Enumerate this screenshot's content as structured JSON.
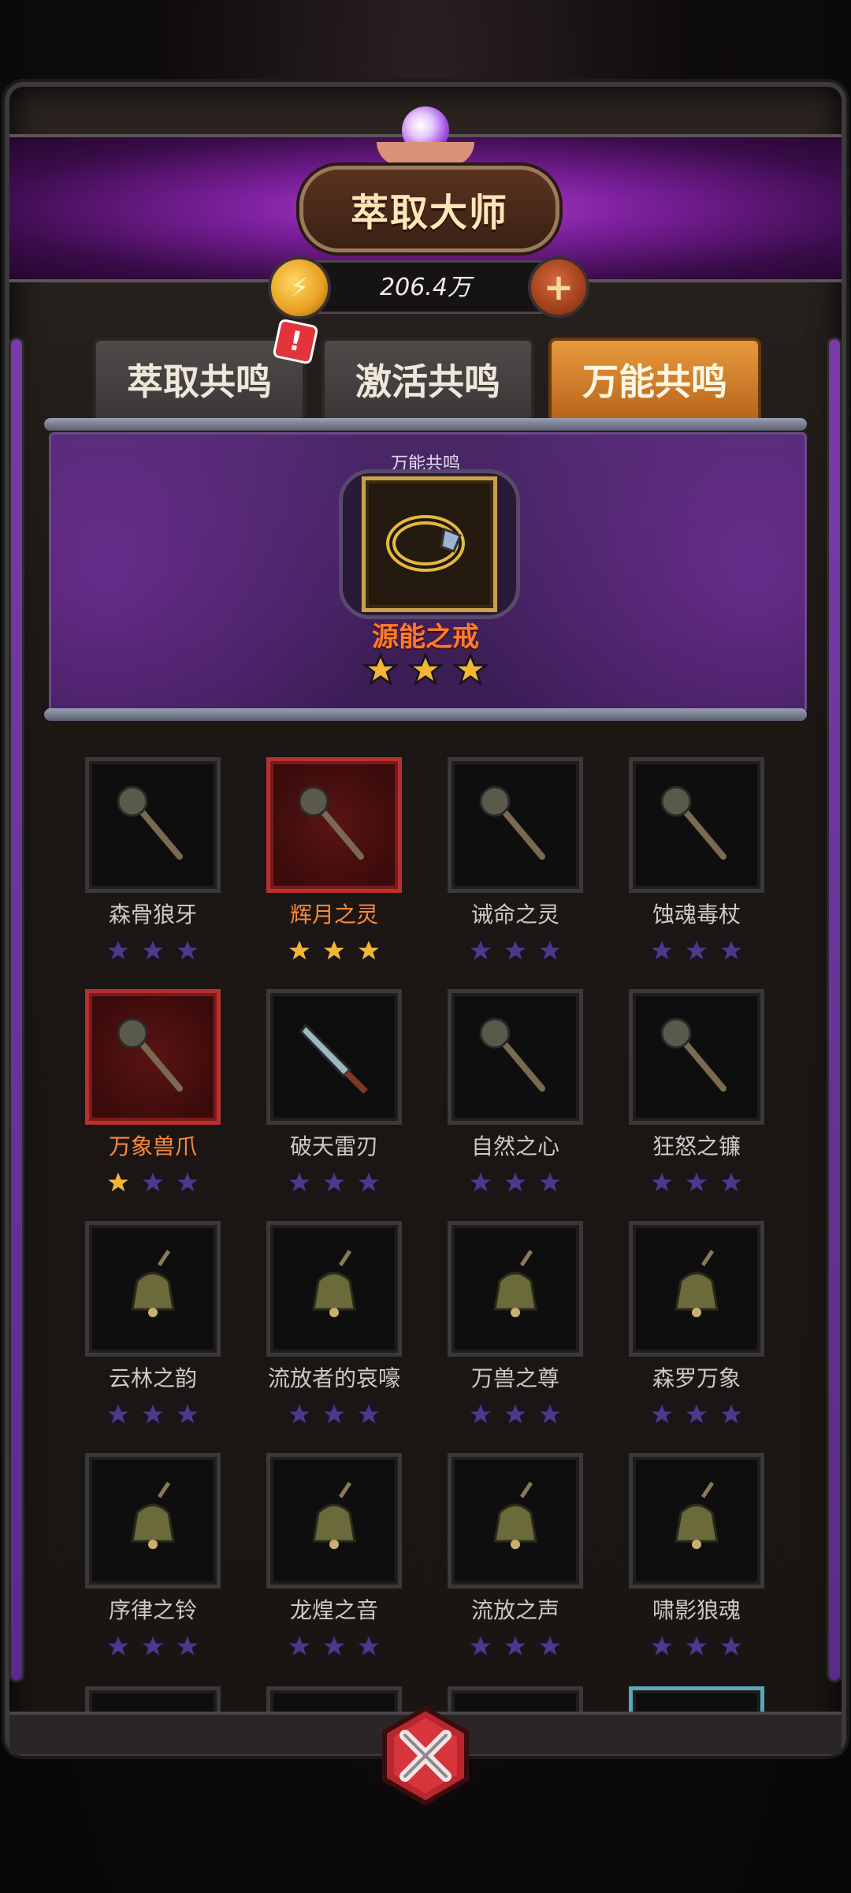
{
  "header": {
    "title": "萃取大师"
  },
  "currency": {
    "icon": "gold-coin-icon",
    "value": "206.4万",
    "add_label": "+"
  },
  "tabs": [
    {
      "label": "萃取共鸣",
      "active": false,
      "badge": "!"
    },
    {
      "label": "激活共鸣",
      "active": false
    },
    {
      "label": "万能共鸣",
      "active": true
    }
  ],
  "featured": {
    "label": "万能共鸣",
    "name": "源能之戒",
    "stars": 3,
    "icon": "ring-icon"
  },
  "items": [
    {
      "name": "森骨狼牙",
      "stars": 0,
      "icon": "axe-icon"
    },
    {
      "name": "辉月之灵",
      "stars": 3,
      "icon": "moon-staff-icon",
      "highlight": true
    },
    {
      "name": "诫命之灵",
      "stars": 0,
      "icon": "mace-icon"
    },
    {
      "name": "蚀魂毒杖",
      "stars": 0,
      "icon": "skull-staff-icon"
    },
    {
      "name": "万象兽爪",
      "stars": 1,
      "icon": "claw-staff-icon",
      "highlight": true
    },
    {
      "name": "破天雷刃",
      "stars": 0,
      "icon": "blade-icon"
    },
    {
      "name": "自然之心",
      "stars": 0,
      "icon": "nature-staff-icon"
    },
    {
      "name": "狂怒之镰",
      "stars": 0,
      "icon": "scythe-icon"
    },
    {
      "name": "云林之韵",
      "stars": 0,
      "icon": "bell-icon"
    },
    {
      "name": "流放者的哀嚎",
      "stars": 0,
      "icon": "bell-icon"
    },
    {
      "name": "万兽之尊",
      "stars": 0,
      "icon": "bell-icon"
    },
    {
      "name": "森罗万象",
      "stars": 0,
      "icon": "bell-icon"
    },
    {
      "name": "序律之铃",
      "stars": 0,
      "icon": "bell-icon"
    },
    {
      "name": "龙煌之音",
      "stars": 0,
      "icon": "bell-icon"
    },
    {
      "name": "流放之声",
      "stars": 0,
      "icon": "bell-icon"
    },
    {
      "name": "啸影狼魂",
      "stars": 0,
      "icon": "bell-icon"
    }
  ],
  "colors": {
    "accent_purple": "#7a1f9a",
    "tab_active": "#e79a3c",
    "star_gold": "#f2b632",
    "star_empty": "#4a3a8a",
    "name_highlight": "#ff8a3a",
    "frame_red": "#b83030"
  },
  "close_icon": "close-x-icon"
}
